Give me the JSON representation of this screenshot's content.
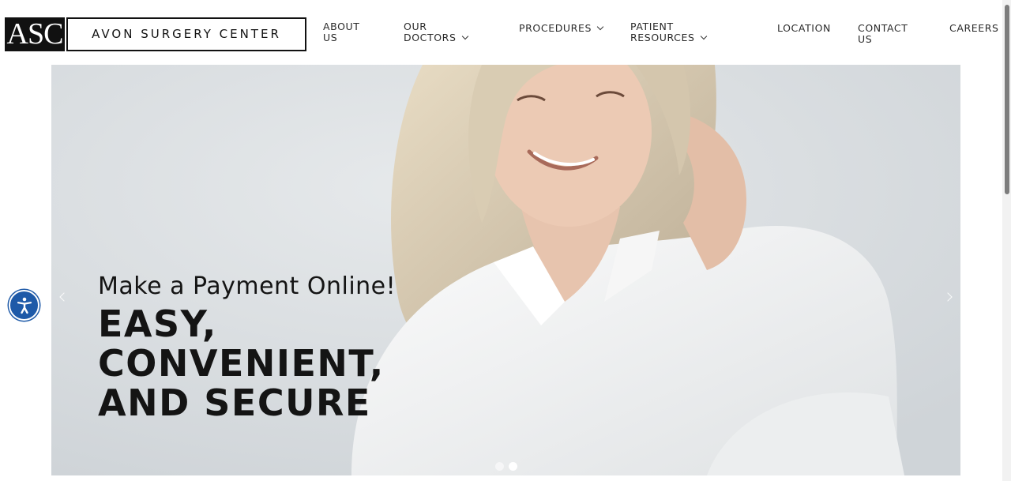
{
  "brand": {
    "mark": "ASC",
    "name": "AVON SURGERY CENTER"
  },
  "nav": {
    "about": [
      "ABOUT",
      "US"
    ],
    "doctors": [
      "OUR",
      "DOCTORS"
    ],
    "procedures": "PROCEDURES",
    "patient": [
      "PATIENT",
      "RESOURCES"
    ],
    "location": "LOCATION",
    "contact": [
      "CONTACT",
      "US"
    ],
    "careers": "CAREERS"
  },
  "hero": {
    "subtitle": "Make a Payment Online!",
    "headline": [
      "EASY,",
      "CONVENIENT,",
      "AND SECURE"
    ],
    "slide_count": 2,
    "active_slide": 2
  },
  "icons": {
    "accessibility": "accessibility-icon",
    "prev": "chevron-left-icon",
    "next": "chevron-right-icon",
    "dropdown": "chevron-down-icon"
  },
  "colors": {
    "accessibility_button": "#1e5aa8",
    "logo_dark": "#111111"
  }
}
